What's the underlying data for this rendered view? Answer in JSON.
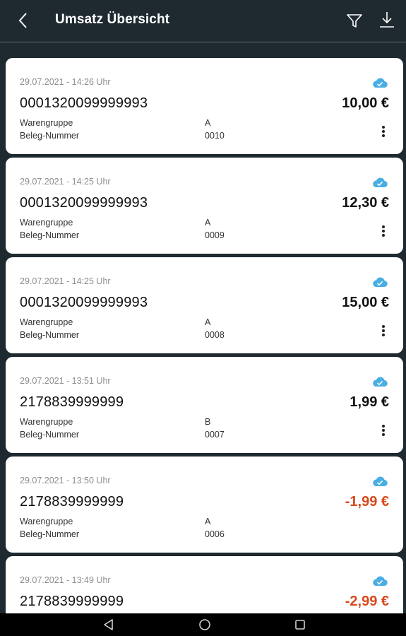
{
  "app_bar": {
    "title": "Umsatz Übersicht",
    "back_icon": "back-arrow-icon",
    "filter_icon": "filter-icon",
    "download_icon": "download-icon"
  },
  "colors": {
    "header_bg": "#1f2a30",
    "card_bg": "#ffffff",
    "negative_amount": "#d84a1b",
    "cloud_icon": "#4aaee3"
  },
  "transactions": [
    {
      "timestamp": "29.07.2021 - 14:26 Uhr",
      "number": "0001320099999993",
      "amount": "10,00 €",
      "group_label": "Warengruppe",
      "group_value": "A",
      "receipt_label": "Beleg-Nummer",
      "receipt_value": "0010"
    },
    {
      "timestamp": "29.07.2021 - 14:25 Uhr",
      "number": "0001320099999993",
      "amount": "12,30 €",
      "group_label": "Warengruppe",
      "group_value": "A",
      "receipt_label": "Beleg-Nummer",
      "receipt_value": "0009"
    },
    {
      "timestamp": "29.07.2021 - 14:25 Uhr",
      "number": "0001320099999993",
      "amount": "15,00 €",
      "group_label": "Warengruppe",
      "group_value": "A",
      "receipt_label": "Beleg-Nummer",
      "receipt_value": "0008"
    },
    {
      "timestamp": "29.07.2021 - 13:51 Uhr",
      "number": "2178839999999",
      "amount": "1,99 €",
      "group_label": "Warengruppe",
      "group_value": "B",
      "receipt_label": "Beleg-Nummer",
      "receipt_value": "0007"
    },
    {
      "timestamp": "29.07.2021 - 13:50 Uhr",
      "number": "2178839999999",
      "amount": "-1,99 €",
      "group_label": "Warengruppe",
      "group_value": "A",
      "receipt_label": "Beleg-Nummer",
      "receipt_value": "0006"
    },
    {
      "timestamp": "29.07.2021 - 13:49 Uhr",
      "number": "2178839999999",
      "amount": "-2,99 €"
    }
  ],
  "system_nav": {
    "back_icon": "nav-back-triangle-icon",
    "home_icon": "nav-home-circle-icon",
    "recents_icon": "nav-recents-square-icon"
  }
}
